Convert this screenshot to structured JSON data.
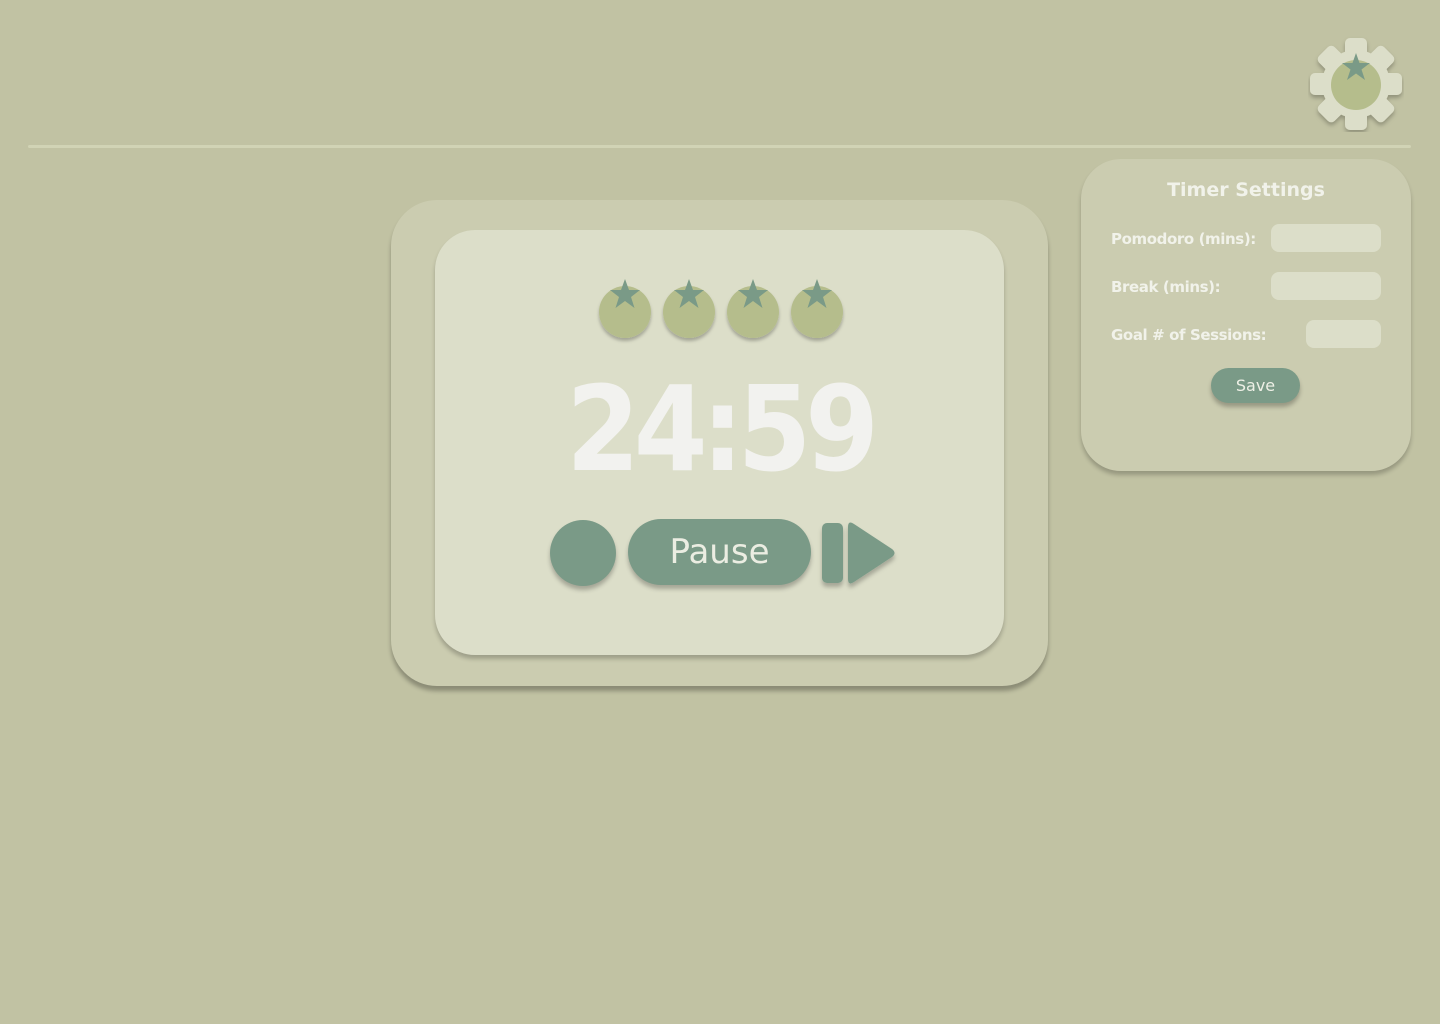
{
  "header": {
    "settings_icon": "gear-tomato-icon"
  },
  "timer": {
    "display": "24:59",
    "session_icon": "tomato-icon",
    "sessions_shown": 4
  },
  "controls": {
    "reset_icon": "circle-icon",
    "pause_label": "Pause",
    "skip_icon": "skip-forward-icon"
  },
  "settings": {
    "title": "Timer Settings",
    "pomodoro_label": "Pomodoro (mins):",
    "pomodoro_value": "",
    "break_label": "Break (mins):",
    "break_value": "",
    "goal_label": "Goal # of Sessions:",
    "goal_value": "",
    "save_label": "Save"
  },
  "colors": {
    "background": "#c1c2a3",
    "card_outer": "#cbccb0",
    "card_inner": "#dcdec9",
    "accent": "#7a9a87",
    "tomato": "#b5bd8c",
    "text_light": "#f2f2ef"
  }
}
